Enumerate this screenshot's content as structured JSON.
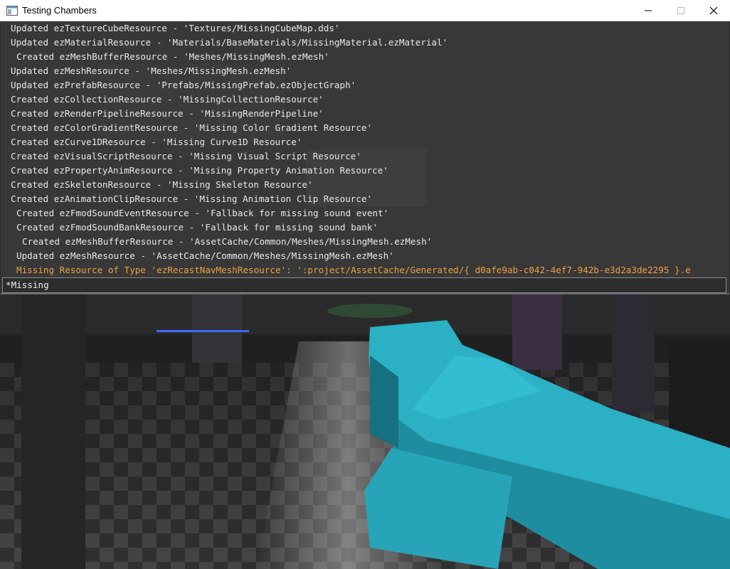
{
  "window": {
    "title": "Testing Chambers",
    "controls": {
      "minimize_icon": "minimize-icon",
      "maximize_icon": "maximize-icon",
      "close_icon": "close-icon"
    }
  },
  "console": {
    "lines": [
      {
        "text": "Updated ezTextureCubeResource - 'Textures/MissingCubeMap.dds'",
        "indent": 14,
        "kind": "info"
      },
      {
        "text": "Updated ezMaterialResource - 'Materials/BaseMaterials/MissingMaterial.ezMaterial'",
        "indent": 14,
        "kind": "info"
      },
      {
        "text": "Created ezMeshBufferResource - 'Meshes/MissingMesh.ezMesh'",
        "indent": 22,
        "kind": "info"
      },
      {
        "text": "Updated ezMeshResource - 'Meshes/MissingMesh.ezMesh'",
        "indent": 14,
        "kind": "info"
      },
      {
        "text": "Updated ezPrefabResource - 'Prefabs/MissingPrefab.ezObjectGraph'",
        "indent": 14,
        "kind": "info"
      },
      {
        "text": "Created ezCollectionResource - 'MissingCollectionResource'",
        "indent": 14,
        "kind": "info"
      },
      {
        "text": "Created ezRenderPipelineResource - 'MissingRenderPipeline'",
        "indent": 14,
        "kind": "info"
      },
      {
        "text": "Created ezColorGradientResource - 'Missing Color Gradient Resource'",
        "indent": 14,
        "kind": "info"
      },
      {
        "text": "Created ezCurve1DResource - 'Missing Curve1D Resource'",
        "indent": 14,
        "kind": "info"
      },
      {
        "text": "Created ezVisualScriptResource - 'Missing Visual Script Resource'",
        "indent": 14,
        "kind": "info"
      },
      {
        "text": "Created ezPropertyAnimResource - 'Missing Property Animation Resource'",
        "indent": 14,
        "kind": "info"
      },
      {
        "text": "Created ezSkeletonResource - 'Missing Skeleton Resource'",
        "indent": 14,
        "kind": "info"
      },
      {
        "text": "Created ezAnimationClipResource - 'Missing Animation Clip Resource'",
        "indent": 14,
        "kind": "info"
      },
      {
        "text": "Created ezFmodSoundEventResource - 'Fallback for missing sound event'",
        "indent": 22,
        "kind": "info"
      },
      {
        "text": "Created ezFmodSoundBankResource - 'Fallback for missing sound bank'",
        "indent": 22,
        "kind": "info"
      },
      {
        "text": "Created ezMeshBufferResource - 'AssetCache/Common/Meshes/MissingMesh.ezMesh'",
        "indent": 30,
        "kind": "info"
      },
      {
        "text": "Updated ezMeshResource - 'AssetCache/Common/Meshes/MissingMesh.ezMesh'",
        "indent": 22,
        "kind": "info"
      },
      {
        "text": "Missing Resource of Type 'ezRecastNavMeshResource': ':project/AssetCache/Generated/{ d0afe9ab-c042-4ef7-942b-e3d2a3de2295 }.e",
        "indent": 22,
        "kind": "error"
      }
    ],
    "input_value": "*Missing"
  },
  "colors": {
    "log_text": "#e8e8e8",
    "log_error": "#f0a040",
    "weapon_cyan": "#2bb0c4",
    "console_bg": "rgba(60,60,60,0.78)"
  }
}
